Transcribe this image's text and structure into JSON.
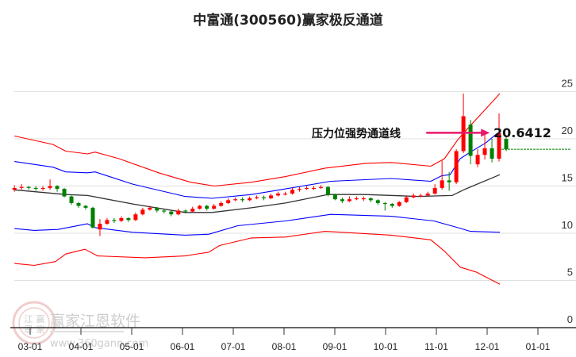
{
  "chart_data": {
    "type": "line",
    "subtype": "candlestick-with-channels",
    "title": "中富通(300560)赢家极反通道",
    "xlabel": "",
    "ylabel": "",
    "ylim": [
      0,
      25
    ],
    "yticks": [
      0,
      5,
      10,
      15,
      20,
      25
    ],
    "grid": true,
    "x_unit": "months since 03-01",
    "xticks": [
      {
        "t": 0,
        "label": "03-01"
      },
      {
        "t": 1,
        "label": "04-01"
      },
      {
        "t": 2,
        "label": "05-01"
      },
      {
        "t": 3,
        "label": "06-01"
      },
      {
        "t": 4,
        "label": "07-01"
      },
      {
        "t": 5,
        "label": "08-01"
      },
      {
        "t": 6,
        "label": "09-01"
      },
      {
        "t": 7,
        "label": "10-01"
      },
      {
        "t": 8,
        "label": "11-01"
      },
      {
        "t": 9,
        "label": "12-01"
      },
      {
        "t": 10,
        "label": "01-01"
      }
    ],
    "candles": {
      "t_start": -0.31,
      "t_end": 9.375,
      "colors": {
        "up": "#ff0000",
        "down": "#008000"
      },
      "ohlc": [
        [
          14.6,
          14.8,
          15.1,
          14.4
        ],
        [
          14.8,
          14.9,
          15.2,
          14.6
        ],
        [
          14.9,
          14.8,
          15.0,
          14.6
        ],
        [
          14.8,
          14.7,
          15.0,
          14.5
        ],
        [
          14.7,
          14.8,
          15.0,
          14.5
        ],
        [
          14.8,
          15.0,
          15.7,
          14.6
        ],
        [
          15.0,
          14.7,
          15.1,
          14.4
        ],
        [
          14.7,
          13.9,
          14.8,
          13.8
        ],
        [
          13.9,
          13.2,
          14.0,
          13.0
        ],
        [
          13.2,
          12.9,
          13.3,
          12.7
        ],
        [
          12.9,
          12.7,
          13.0,
          12.5
        ],
        [
          12.7,
          10.6,
          12.8,
          10.5
        ],
        [
          10.4,
          11.0,
          11.5,
          9.7
        ],
        [
          11.0,
          11.4,
          11.6,
          10.9
        ],
        [
          11.4,
          11.3,
          11.6,
          11.1
        ],
        [
          11.3,
          11.6,
          11.8,
          11.2
        ],
        [
          11.6,
          11.4,
          11.7,
          11.2
        ],
        [
          11.4,
          12.0,
          12.2,
          11.3
        ],
        [
          12.0,
          12.5,
          12.7,
          11.9
        ],
        [
          12.5,
          12.7,
          12.9,
          12.4
        ],
        [
          12.7,
          12.4,
          12.8,
          12.2
        ],
        [
          12.4,
          12.3,
          12.6,
          12.1
        ],
        [
          12.3,
          12.0,
          12.4,
          11.8
        ],
        [
          12.0,
          12.4,
          12.6,
          11.9
        ],
        [
          12.4,
          12.3,
          12.5,
          12.1
        ],
        [
          12.3,
          12.6,
          12.8,
          12.2
        ],
        [
          12.6,
          12.9,
          13.0,
          12.5
        ],
        [
          12.9,
          12.6,
          13.0,
          12.4
        ],
        [
          12.6,
          12.9,
          13.1,
          12.5
        ],
        [
          12.9,
          13.2,
          13.4,
          12.8
        ],
        [
          13.2,
          13.5,
          13.7,
          13.1
        ],
        [
          13.5,
          13.6,
          13.8,
          13.4
        ],
        [
          13.6,
          13.5,
          13.8,
          13.3
        ],
        [
          13.5,
          13.7,
          13.9,
          13.4
        ],
        [
          13.7,
          13.8,
          14.0,
          13.6
        ],
        [
          13.8,
          13.7,
          14.0,
          13.5
        ],
        [
          13.7,
          14.0,
          14.2,
          13.6
        ],
        [
          14.0,
          14.2,
          14.4,
          13.9
        ],
        [
          14.2,
          14.2,
          14.4,
          14.0
        ],
        [
          14.2,
          14.6,
          14.8,
          14.1
        ],
        [
          14.6,
          14.7,
          14.9,
          14.4
        ],
        [
          14.7,
          14.8,
          15.0,
          14.6
        ],
        [
          14.8,
          14.8,
          15.0,
          14.6
        ],
        [
          14.8,
          14.9,
          15.1,
          14.7
        ],
        [
          14.9,
          14.1,
          15.0,
          13.9
        ],
        [
          14.1,
          13.6,
          14.2,
          13.5
        ],
        [
          13.6,
          13.4,
          13.8,
          13.2
        ],
        [
          13.4,
          13.6,
          13.9,
          13.3
        ],
        [
          13.6,
          13.7,
          13.9,
          13.5
        ],
        [
          13.7,
          13.7,
          13.9,
          13.4
        ],
        [
          13.7,
          13.5,
          13.8,
          13.3
        ],
        [
          13.5,
          13.2,
          13.6,
          13.0
        ],
        [
          13.2,
          13.1,
          13.3,
          12.4
        ],
        [
          13.1,
          12.9,
          13.2,
          12.7
        ],
        [
          12.9,
          13.3,
          13.4,
          12.8
        ],
        [
          13.3,
          13.8,
          14.0,
          13.2
        ],
        [
          13.8,
          14.0,
          14.2,
          13.7
        ],
        [
          14.0,
          14.0,
          14.2,
          13.8
        ],
        [
          14.0,
          14.2,
          14.4,
          13.9
        ],
        [
          14.2,
          14.8,
          15.2,
          14.1
        ],
        [
          14.8,
          15.6,
          17.7,
          14.6
        ],
        [
          15.6,
          15.4,
          16.5,
          14.5
        ],
        [
          15.4,
          18.7,
          18.9,
          15.2
        ],
        [
          18.7,
          22.4,
          24.8,
          18.5
        ],
        [
          21.5,
          18.2,
          22.0,
          17.3
        ],
        [
          17.3,
          18.3,
          18.9,
          17.0
        ],
        [
          18.3,
          19.0,
          20.5,
          17.8
        ],
        [
          19.0,
          17.9,
          20.0,
          17.5
        ],
        [
          17.9,
          20.6,
          22.7,
          17.6
        ],
        [
          20.0,
          18.9,
          20.4,
          18.7
        ]
      ]
    },
    "series": [
      {
        "name": "upper-outer",
        "color": "#ff0000",
        "t": [
          -0.31,
          0.45,
          0.7,
          1.13,
          1.28,
          1.75,
          2.53,
          3.16,
          3.63,
          4.36,
          5.03,
          5.81,
          6.61,
          7.11,
          7.89,
          8.16,
          8.42,
          8.67,
          8.98,
          9.25
        ],
        "values": [
          20.3,
          19.4,
          18.7,
          18.4,
          18.6,
          17.9,
          16.4,
          15.4,
          15.0,
          15.4,
          16.0,
          16.9,
          17.4,
          17.5,
          17.1,
          17.9,
          19.9,
          21.4,
          23.2,
          24.8
        ]
      },
      {
        "name": "upper-inner",
        "color": "#0000ff",
        "t": [
          -0.31,
          0.45,
          0.7,
          1.13,
          1.28,
          2.02,
          3.05,
          3.58,
          4.36,
          5.03,
          5.92,
          7.11,
          7.89,
          8.11,
          8.27,
          8.47,
          8.67,
          8.98,
          9.2
        ],
        "values": [
          17.6,
          17.0,
          16.5,
          16.4,
          16.5,
          15.2,
          13.9,
          13.7,
          14.1,
          14.7,
          15.5,
          15.8,
          15.5,
          16.1,
          16.2,
          17.9,
          18.6,
          19.6,
          20.6
        ]
      },
      {
        "name": "middle",
        "color": "#333333",
        "t": [
          -0.31,
          0.7,
          1.13,
          2.02,
          3.05,
          3.58,
          4.36,
          5.03,
          5.86,
          6.59,
          7.64,
          8.31,
          8.58,
          9.25
        ],
        "values": [
          14.6,
          14.1,
          14.0,
          13.1,
          12.2,
          12.2,
          12.7,
          13.2,
          14.1,
          14.1,
          13.9,
          14.0,
          14.7,
          16.2
        ]
      },
      {
        "name": "lower-inner",
        "color": "#0000ff",
        "t": [
          -0.31,
          0.08,
          0.55,
          1.13,
          1.28,
          2.02,
          3.05,
          3.52,
          4.09,
          5.03,
          5.92,
          7.11,
          7.95,
          8.42,
          8.67,
          9.25
        ],
        "values": [
          10.5,
          10.3,
          10.4,
          11.0,
          10.6,
          10.1,
          9.8,
          9.9,
          10.8,
          11.3,
          12.0,
          11.8,
          11.3,
          10.6,
          10.2,
          10.1
        ]
      },
      {
        "name": "lower-outer",
        "color": "#ff0000",
        "t": [
          -0.31,
          0.08,
          0.5,
          0.7,
          1.08,
          1.33,
          2.27,
          3.05,
          3.52,
          3.73,
          4.36,
          5.03,
          5.81,
          7.11,
          7.89,
          8.16,
          8.47,
          8.78,
          9.25
        ],
        "values": [
          6.8,
          6.6,
          7.0,
          7.8,
          8.3,
          7.6,
          7.4,
          7.6,
          8.0,
          8.7,
          9.5,
          9.6,
          10.2,
          9.8,
          9.3,
          8.1,
          6.4,
          5.9,
          4.6
        ]
      }
    ],
    "last_close_line": {
      "value": 18.9,
      "color": "#008000"
    },
    "annotation": {
      "text": "压力位强势通道线",
      "value_label": "20.6412",
      "value": 20.6412,
      "arrow_color": "#e8186a",
      "arrow_from_t": 7.8,
      "arrow_to_t": 9.05
    },
    "watermark": {
      "logo_text": [
        "江",
        "赢",
        "恩",
        "家"
      ],
      "name": "赢家江恩软件",
      "url": "www.360gann.com"
    }
  }
}
